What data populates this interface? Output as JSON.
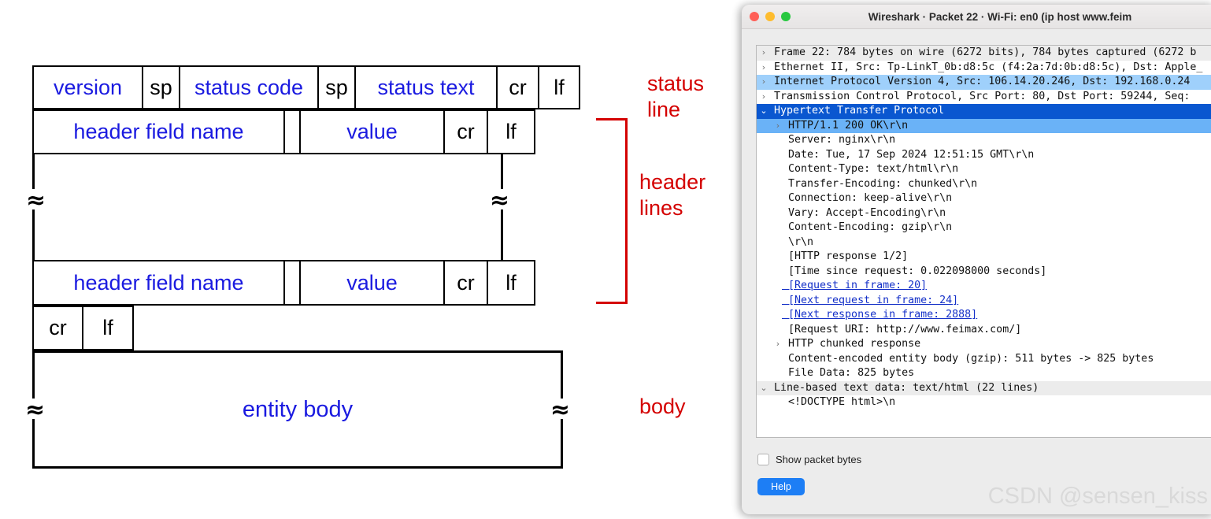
{
  "diagram": {
    "status_line": {
      "cells": [
        {
          "text": "version",
          "color": "blue"
        },
        {
          "text": "sp",
          "color": "black"
        },
        {
          "text": "status code",
          "color": "blue"
        },
        {
          "text": "sp",
          "color": "black"
        },
        {
          "text": "status text",
          "color": "blue"
        },
        {
          "text": "cr",
          "color": "black"
        },
        {
          "text": "lf",
          "color": "black"
        }
      ]
    },
    "header_line_1": {
      "cells": [
        {
          "text": "header field name",
          "color": "blue"
        },
        {
          "text": "",
          "color": "black"
        },
        {
          "text": "value",
          "color": "blue"
        },
        {
          "text": "cr",
          "color": "black"
        },
        {
          "text": "lf",
          "color": "black"
        }
      ]
    },
    "header_line_2": {
      "cells": [
        {
          "text": "header field name",
          "color": "blue"
        },
        {
          "text": "",
          "color": "black"
        },
        {
          "text": "value",
          "color": "blue"
        },
        {
          "text": "cr",
          "color": "black"
        },
        {
          "text": "lf",
          "color": "black"
        }
      ]
    },
    "blank_line": {
      "cells": [
        {
          "text": "cr",
          "color": "black"
        },
        {
          "text": "lf",
          "color": "black"
        }
      ]
    },
    "entity_body_label": "entity body",
    "break_glyph": "≈",
    "annotations": {
      "status_line": "status\nline",
      "header_lines": "header\nlines",
      "body": "body"
    },
    "colors": {
      "text_blue": "#1a1ae0",
      "annotation_red": "#d40000",
      "border": "#000000"
    }
  },
  "wireshark": {
    "title": "Wireshark · Packet 22 · Wi-Fi: en0 (ip host www.feim",
    "traffic_lights": [
      "close-red",
      "minimize-yellow",
      "maximize-green"
    ],
    "tree": [
      {
        "indent": 0,
        "arrow": "›",
        "text": "Frame 22: 784 bytes on wire (6272 bits), 784 bytes captured (6272 b",
        "style": "alt"
      },
      {
        "indent": 0,
        "arrow": "›",
        "text": "Ethernet II, Src: Tp-LinkT_0b:d8:5c (f4:2a:7d:0b:d8:5c), Dst: Apple_",
        "style": "plain"
      },
      {
        "indent": 0,
        "arrow": "›",
        "text": "Internet Protocol Version 4, Src: 106.14.20.246, Dst: 192.168.0.24",
        "style": "lightsel"
      },
      {
        "indent": 0,
        "arrow": "›",
        "text": "Transmission Control Protocol, Src Port: 80, Dst Port: 59244, Seq: ",
        "style": "plain"
      },
      {
        "indent": 0,
        "arrow": "⌄",
        "text": "Hypertext Transfer Protocol",
        "style": "sel"
      },
      {
        "indent": 1,
        "arrow": "›",
        "text": "HTTP/1.1 200 OK\\r\\n",
        "style": "sel2"
      },
      {
        "indent": 1,
        "arrow": "",
        "text": "Server: nginx\\r\\n",
        "style": "plain"
      },
      {
        "indent": 1,
        "arrow": "",
        "text": "Date: Tue, 17 Sep 2024 12:51:15 GMT\\r\\n",
        "style": "plain"
      },
      {
        "indent": 1,
        "arrow": "",
        "text": "Content-Type: text/html\\r\\n",
        "style": "plain"
      },
      {
        "indent": 1,
        "arrow": "",
        "text": "Transfer-Encoding: chunked\\r\\n",
        "style": "plain"
      },
      {
        "indent": 1,
        "arrow": "",
        "text": "Connection: keep-alive\\r\\n",
        "style": "plain"
      },
      {
        "indent": 1,
        "arrow": "",
        "text": "Vary: Accept-Encoding\\r\\n",
        "style": "plain"
      },
      {
        "indent": 1,
        "arrow": "",
        "text": "Content-Encoding: gzip\\r\\n",
        "style": "plain"
      },
      {
        "indent": 1,
        "arrow": "",
        "text": "\\r\\n",
        "style": "plain"
      },
      {
        "indent": 1,
        "arrow": "",
        "text": "[HTTP response 1/2]",
        "style": "plain"
      },
      {
        "indent": 1,
        "arrow": "",
        "text": "[Time since request: 0.022098000 seconds]",
        "style": "plain"
      },
      {
        "indent": 1,
        "arrow": "",
        "text": "[Request in frame: 20]",
        "style": "link"
      },
      {
        "indent": 1,
        "arrow": "",
        "text": "[Next request in frame: 24]",
        "style": "link"
      },
      {
        "indent": 1,
        "arrow": "",
        "text": "[Next response in frame: 2888]",
        "style": "link"
      },
      {
        "indent": 1,
        "arrow": "",
        "text": "[Request URI: http://www.feimax.com/]",
        "style": "plain"
      },
      {
        "indent": 0,
        "arrow": "›",
        "text": "HTTP chunked response",
        "style": "plain",
        "arrow_indent": 1
      },
      {
        "indent": 1,
        "arrow": "",
        "text": "Content-encoded entity body (gzip): 511 bytes -> 825 bytes",
        "style": "plain"
      },
      {
        "indent": 1,
        "arrow": "",
        "text": "File Data: 825 bytes",
        "style": "plain"
      },
      {
        "indent": 0,
        "arrow": "⌄",
        "text": "Line-based text data: text/html (22 lines)",
        "style": "alt"
      },
      {
        "indent": 1,
        "arrow": "",
        "text": "<!DOCTYPE html>\\n",
        "style": "plain"
      }
    ],
    "show_packet_bytes_label": "Show packet bytes",
    "show_packet_bytes_checked": false,
    "help_label": "Help",
    "watermark": "CSDN @sensen_kiss",
    "colors": {
      "selection": "#0a57d0",
      "selection_child": "#6ab2f7",
      "light_selection": "#9fd0fb",
      "help_button": "#1d7ef5"
    }
  }
}
